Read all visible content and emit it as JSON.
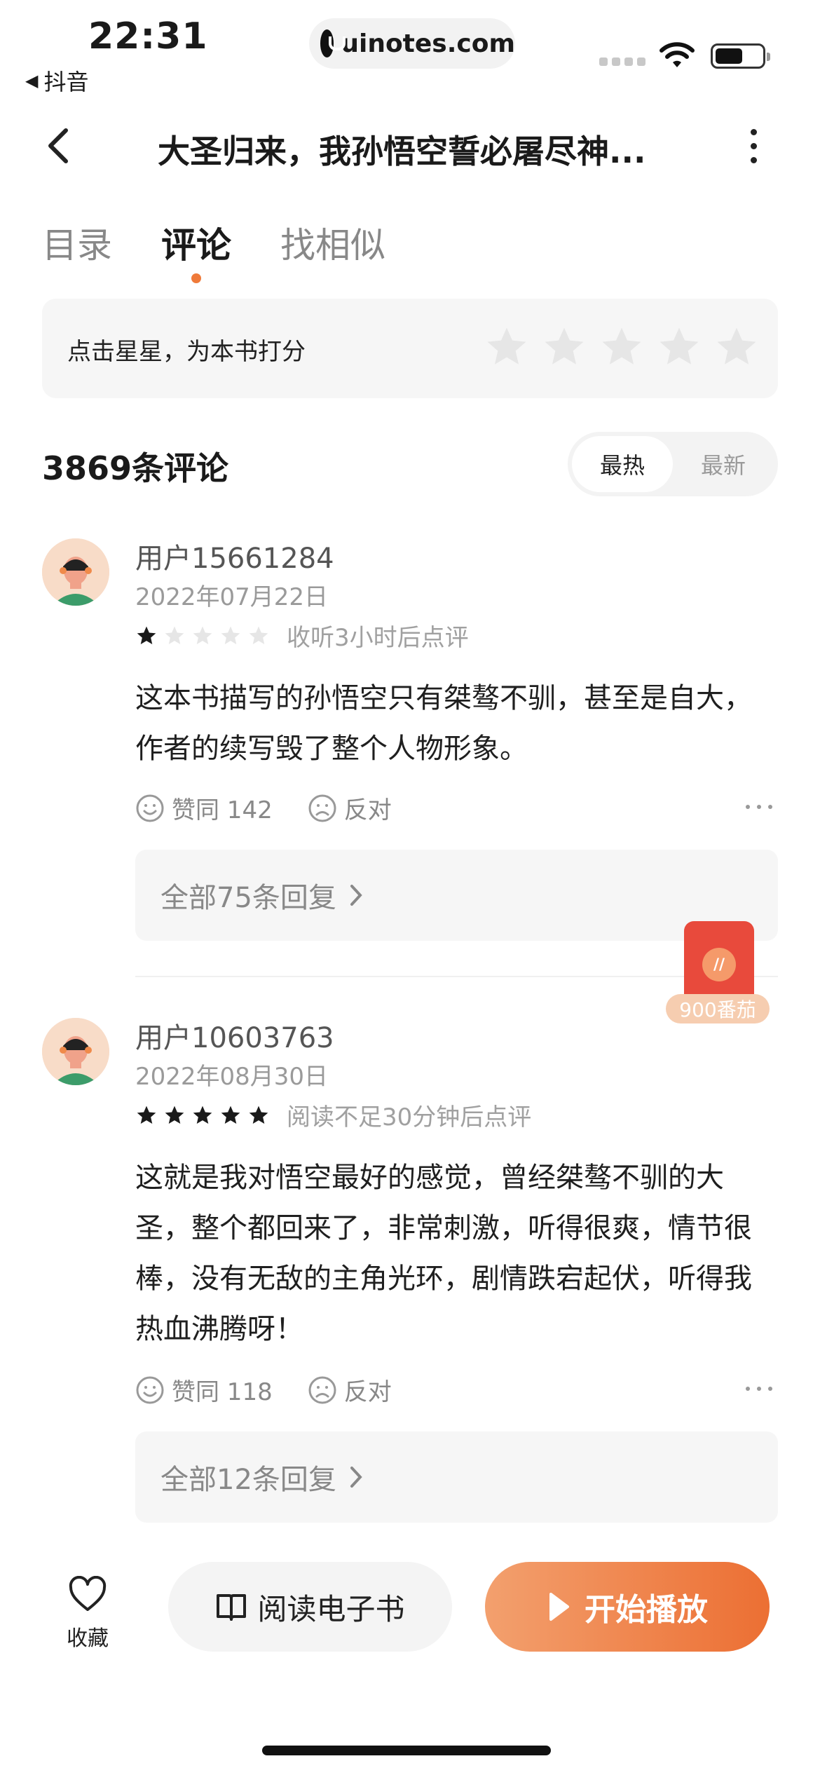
{
  "status_bar": {
    "time": "22:31",
    "back_app": "抖音",
    "url": "uinotes.com"
  },
  "header": {
    "title": "大圣归来，我孙悟空誓必屠尽神..."
  },
  "tabs": [
    {
      "label": "目录",
      "active": false
    },
    {
      "label": "评论",
      "active": true
    },
    {
      "label": "找相似",
      "active": false
    }
  ],
  "rating_prompt": {
    "label": "点击星星，为本书打分",
    "stars": 5
  },
  "comments_header": {
    "count_label": "3869条评论",
    "sort_hot": "最热",
    "sort_new": "最新",
    "active_sort": "最热"
  },
  "comments": [
    {
      "user": "用户15661284",
      "date": "2022年07月22日",
      "rating": 1,
      "rating_note": "收听3小时后点评",
      "text": "这本书描写的孙悟空只有桀骜不驯，甚至是自大，作者的续写毁了整个人物形象。",
      "like_label": "赞同 142",
      "dislike_label": "反对",
      "replies_label": "全部75条回复"
    },
    {
      "user": "用户10603763",
      "date": "2022年08月30日",
      "rating": 5,
      "rating_note": "阅读不足30分钟后点评",
      "text": "这就是我对悟空最好的感觉，曾经桀骜不驯的大圣，整个都回来了，非常刺激，听得很爽，情节很棒，没有无敌的主角光环，剧情跌宕起伏，听得我热血沸腾呀！",
      "like_label": "赞同 118",
      "dislike_label": "反对",
      "replies_label": "全部12条回复"
    }
  ],
  "floating_reward": {
    "label": "900番茄"
  },
  "bottom_bar": {
    "favorite_label": "收藏",
    "read_label": "阅读电子书",
    "play_label": "开始播放"
  },
  "colors": {
    "accent": "#ec6f33",
    "star_filled": "#1a1a1a",
    "star_empty": "#e6e6e6",
    "red_packet": "#e84a3c"
  }
}
